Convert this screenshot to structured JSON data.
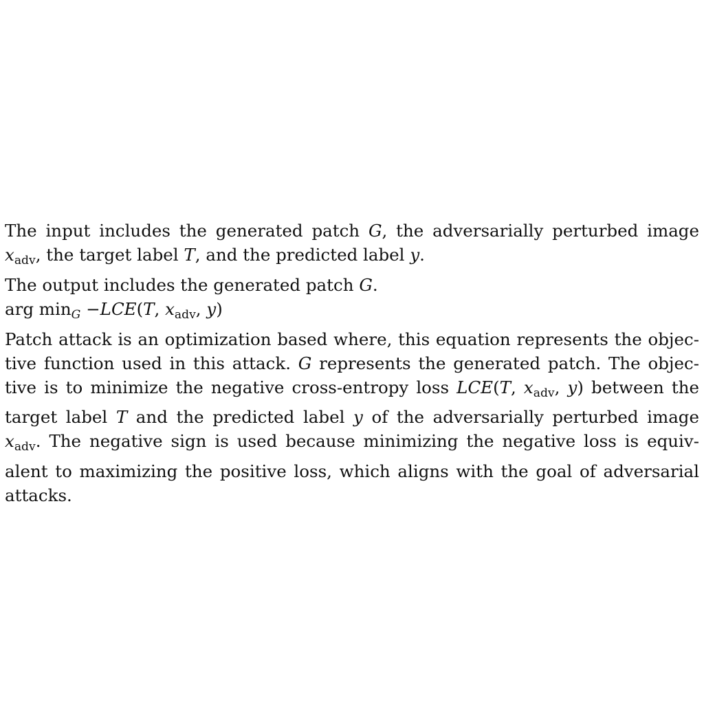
{
  "paragraph_input": {
    "line1_a": "The input includes the generated patch ",
    "G1": "G",
    "line1_b": ", the adversarially perturbed image",
    "x1": "x",
    "adv1": "adv",
    "line2_a": ", the target label ",
    "T1": "T",
    "line2_b": ", and the predicted label ",
    "y1": "y",
    "line2_c": "."
  },
  "paragraph_output": {
    "text_a": "The output includes the generated patch ",
    "G": "G",
    "text_b": "."
  },
  "equation": {
    "argmin": "arg min",
    "sub_G": "G",
    "minus": "−",
    "LCE": "LCE",
    "open": "(",
    "T": "T",
    "comma1": ", ",
    "x": "x",
    "adv": "adv",
    "comma2": ", ",
    "y": "y",
    "close": ")"
  },
  "paragraph_desc": {
    "l1": "Patch attack is an optimization based where, this equation represents the objec-",
    "l2_a": "tive function used in this attack. ",
    "l2_G": "G",
    "l2_b": " represents the generated patch. The objec-",
    "l3_a": "tive is to minimize the negative cross-entropy loss ",
    "l3_LCE": "LCE",
    "l3_open": "(",
    "l3_T": "T",
    "l3_c1": ", ",
    "l3_x": "x",
    "l3_adv": "adv",
    "l3_c2": ", ",
    "l3_y": "y",
    "l3_close": ")",
    "l3_b": " between the",
    "l4_a": "target label ",
    "l4_T": "T",
    "l4_b": " and the predicted label ",
    "l4_y": "y",
    "l4_c": " of the adversarially perturbed image",
    "l5_x": "x",
    "l5_adv": "adv",
    "l5_a": ". The negative sign is used because minimizing the negative loss is equiv-",
    "l6": "alent to maximizing the positive loss, which aligns with the goal of adversarial",
    "l7": "attacks."
  }
}
